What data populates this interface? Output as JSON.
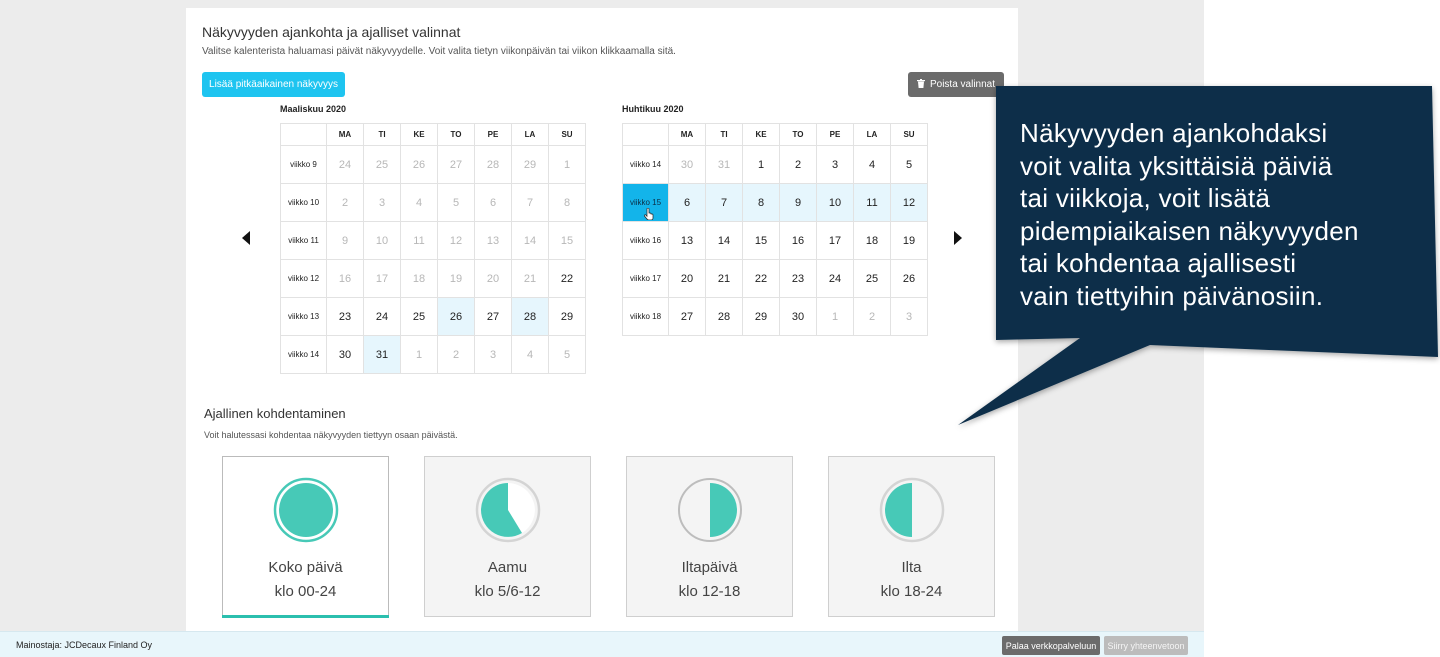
{
  "header": {
    "title": "Näkyvyyden ajankohta ja ajalliset valinnat",
    "subtitle": "Valitse kalenterista haluamasi päivät näkyvyydelle. Voit valita tietyn viikonpäivän tai viikon klikkaamalla sitä.",
    "add_button": "Lisää pitkäaikainen näkyvyys",
    "clear_button": "Poista valinnat"
  },
  "weekdays": [
    "MA",
    "TI",
    "KE",
    "TO",
    "PE",
    "LA",
    "SU"
  ],
  "calendars": [
    {
      "title": "Maaliskuu 2020",
      "weeks": [
        {
          "label": "viikko 9",
          "days": [
            "24",
            "25",
            "26",
            "27",
            "28",
            "29",
            "1"
          ]
        },
        {
          "label": "viikko 10",
          "days": [
            "2",
            "3",
            "4",
            "5",
            "6",
            "7",
            "8"
          ]
        },
        {
          "label": "viikko 11",
          "days": [
            "9",
            "10",
            "11",
            "12",
            "13",
            "14",
            "15"
          ]
        },
        {
          "label": "viikko 12",
          "days": [
            "16",
            "17",
            "18",
            "19",
            "20",
            "21",
            "22"
          ]
        },
        {
          "label": "viikko 13",
          "days": [
            "23",
            "24",
            "25",
            "26",
            "27",
            "28",
            "29"
          ]
        },
        {
          "label": "viikko 14",
          "days": [
            "30",
            "31",
            "1",
            "2",
            "3",
            "4",
            "5"
          ]
        }
      ]
    },
    {
      "title": "Huhtikuu 2020",
      "weeks": [
        {
          "label": "viikko 14",
          "days": [
            "30",
            "31",
            "1",
            "2",
            "3",
            "4",
            "5"
          ]
        },
        {
          "label": "viikko 15",
          "days": [
            "6",
            "7",
            "8",
            "9",
            "10",
            "11",
            "12"
          ]
        },
        {
          "label": "viikko 16",
          "days": [
            "13",
            "14",
            "15",
            "16",
            "17",
            "18",
            "19"
          ]
        },
        {
          "label": "viikko 17",
          "days": [
            "20",
            "21",
            "22",
            "23",
            "24",
            "25",
            "26"
          ]
        },
        {
          "label": "viikko 18",
          "days": [
            "27",
            "28",
            "29",
            "30",
            "1",
            "2",
            "3"
          ]
        }
      ]
    }
  ],
  "targeting": {
    "title": "Ajallinen kohdentaminen",
    "subtitle": "Voit halutessasi kohdentaa näkyvyyden tiettyyn osaan päivästä.",
    "options": [
      {
        "label": "Koko päivä",
        "time": "klo 00-24"
      },
      {
        "label": "Aamu",
        "time": "klo 5/6-12"
      },
      {
        "label": "Iltapäivä",
        "time": "klo 12-18"
      },
      {
        "label": "Ilta",
        "time": "klo 18-24"
      }
    ]
  },
  "footer": {
    "advertiser": "Mainostaja: JCDecaux Finland Oy",
    "back_button": "Palaa verkkopalveluun",
    "next_button": "Siirry yhteenvetoon"
  },
  "callout": {
    "lines": [
      "Näkyvyyden ajankohdaksi",
      "voit valita yksittäisiä päiviä",
      "tai viikkoja, voit lisätä",
      "pidempiaikaisen näkyvyyden",
      "tai kohdentaa ajallisesti",
      "vain tiettyihin päivänosiin."
    ]
  },
  "icons": {
    "prev": "caret-left-icon",
    "next": "caret-right-icon",
    "clear": "trash-icon",
    "cursor": "hand-pointer-icon"
  },
  "colors": {
    "accent": "#1ec4f0",
    "teal": "#47c9b7",
    "selected_day": "#e6f6fd",
    "callout": "#0c2f4a"
  }
}
